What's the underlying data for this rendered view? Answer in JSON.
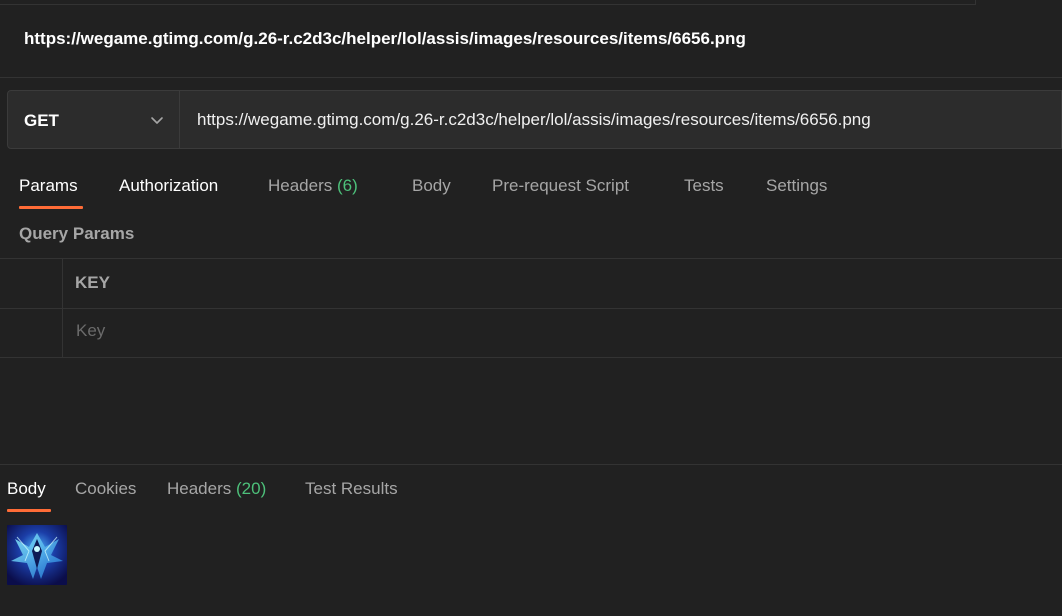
{
  "request": {
    "title": "https://wegame.gtimg.com/g.26-r.c2d3c/helper/lol/assis/images/resources/items/6656.png",
    "method": "GET",
    "url": "https://wegame.gtimg.com/g.26-r.c2d3c/helper/lol/assis/images/resources/items/6656.png"
  },
  "request_tabs": {
    "params": "Params",
    "authorization": "Authorization",
    "headers": "Headers",
    "headers_count": "(6)",
    "body": "Body",
    "pre_request_script": "Pre-request Script",
    "tests": "Tests",
    "settings": "Settings",
    "active": "Params"
  },
  "query_params": {
    "heading": "Query Params",
    "key_header": "KEY",
    "key_placeholder": "Key"
  },
  "response_tabs": {
    "body": "Body",
    "cookies": "Cookies",
    "headers": "Headers",
    "headers_count": "(20)",
    "test_results": "Test Results",
    "active": "Body"
  },
  "colors": {
    "background": "#212121",
    "accent": "#ff6c37",
    "count_green": "#4dc07a"
  },
  "icons": {
    "method_dropdown": "chevron-down-icon",
    "response_preview": "item-image"
  }
}
